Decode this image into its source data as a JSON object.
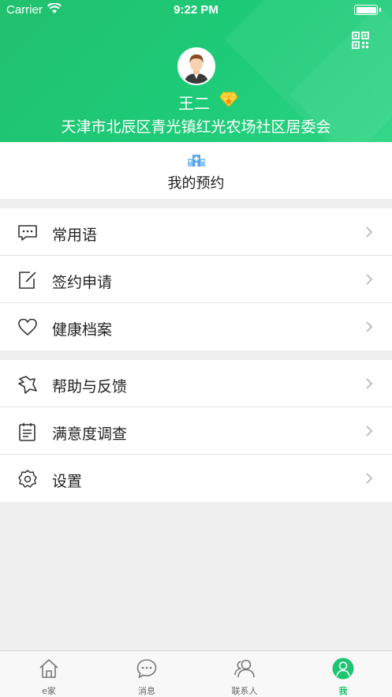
{
  "status_bar": {
    "carrier": "Carrier",
    "time": "9:22 PM"
  },
  "profile": {
    "name": "王二",
    "address": "天津市北辰区青光镇红光农场社区居委会",
    "vip_icon": "diamond-icon",
    "qr_icon": "qr-code-icon"
  },
  "appointment": {
    "label": "我的预约",
    "icon": "hospital-icon"
  },
  "menu_group_1": [
    {
      "label": "常用语",
      "icon": "chat-dots-icon"
    },
    {
      "label": "签约申请",
      "icon": "edit-icon"
    },
    {
      "label": "健康档案",
      "icon": "heart-icon"
    }
  ],
  "menu_group_2": [
    {
      "label": "帮助与反馈",
      "icon": "help-icon"
    },
    {
      "label": "满意度调查",
      "icon": "survey-icon"
    },
    {
      "label": "设置",
      "icon": "gear-icon"
    }
  ],
  "tabs": [
    {
      "label": "e家",
      "icon": "home-icon"
    },
    {
      "label": "消息",
      "icon": "message-icon"
    },
    {
      "label": "联系人",
      "icon": "contacts-icon"
    },
    {
      "label": "我",
      "icon": "me-icon",
      "active": true
    }
  ],
  "colors": {
    "brand_green": "#1fc472",
    "background": "#efefef"
  }
}
